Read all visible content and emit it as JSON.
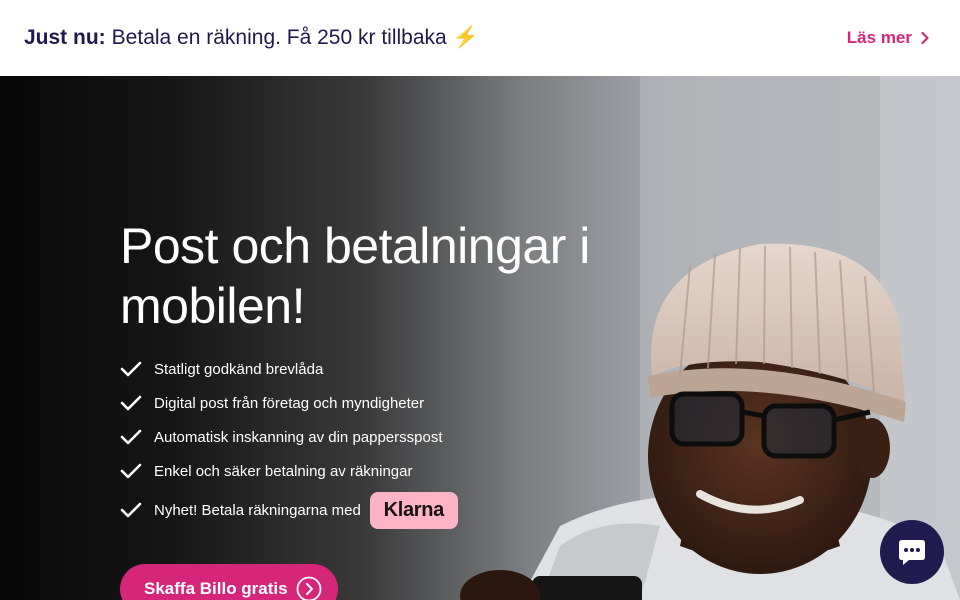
{
  "announcement": {
    "prefix": "Just nu:",
    "text": "Betala en räkning. Få 250 kr tillbaka ⚡",
    "link_label": "Läs mer",
    "link_icon": "chevron-right-icon"
  },
  "hero": {
    "title": "Post och betalningar i mobilen!",
    "features": [
      "Statligt godkänd brevlåda",
      "Digital post från företag och myndigheter",
      "Automatisk inskanning av din pappersspost",
      "Enkel och säker betalning av räkningar"
    ],
    "news_text": "Nyhet! Betala räkningarna med",
    "klarna_label": "Klarna",
    "cta_label": "Skaffa Billo gratis",
    "cta_icon": "arrow-circle-right-icon",
    "check_icon": "checkmark-icon"
  },
  "chat": {
    "icon": "chat-bubble-icon"
  },
  "colors": {
    "brand_pink": "#d6267a",
    "navy": "#1e1a4d",
    "klarna_pink": "#ffb3c7",
    "white": "#ffffff"
  }
}
